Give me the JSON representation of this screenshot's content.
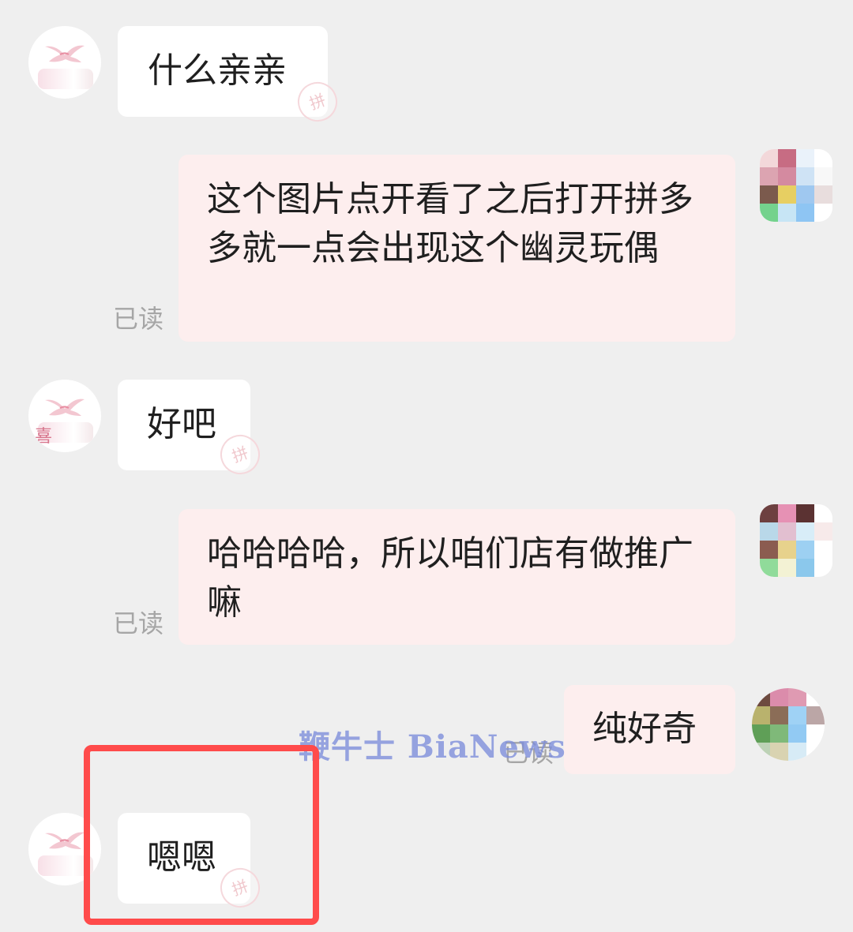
{
  "messages": [
    {
      "id": "m1",
      "side": "left",
      "text": "什么亲亲"
    },
    {
      "id": "m2",
      "side": "right",
      "text": "这个图片点开看了之后打开拼多多就一点会出现这个幽灵玩偶",
      "status": "已读"
    },
    {
      "id": "m3",
      "side": "left",
      "text": "好吧"
    },
    {
      "id": "m4",
      "side": "right",
      "text": "哈哈哈哈，所以咱们店有做推广嘛",
      "status": "已读"
    },
    {
      "id": "m5",
      "side": "right",
      "text": "纯好奇",
      "status": "已读"
    },
    {
      "id": "m6",
      "side": "left",
      "text": "嗯嗯"
    }
  ],
  "shop_avatar": {
    "letter": "喜",
    "icon": "bird-logo-icon"
  },
  "bubble_stamp": "拼",
  "watermark": {
    "text": "鞭牛士 BiaNews"
  },
  "colors": {
    "background": "#efefef",
    "left_bubble": "#ffffff",
    "right_bubble": "#fdeeee",
    "highlight": "#ff4b4b",
    "watermark": "#7d8ddb"
  }
}
